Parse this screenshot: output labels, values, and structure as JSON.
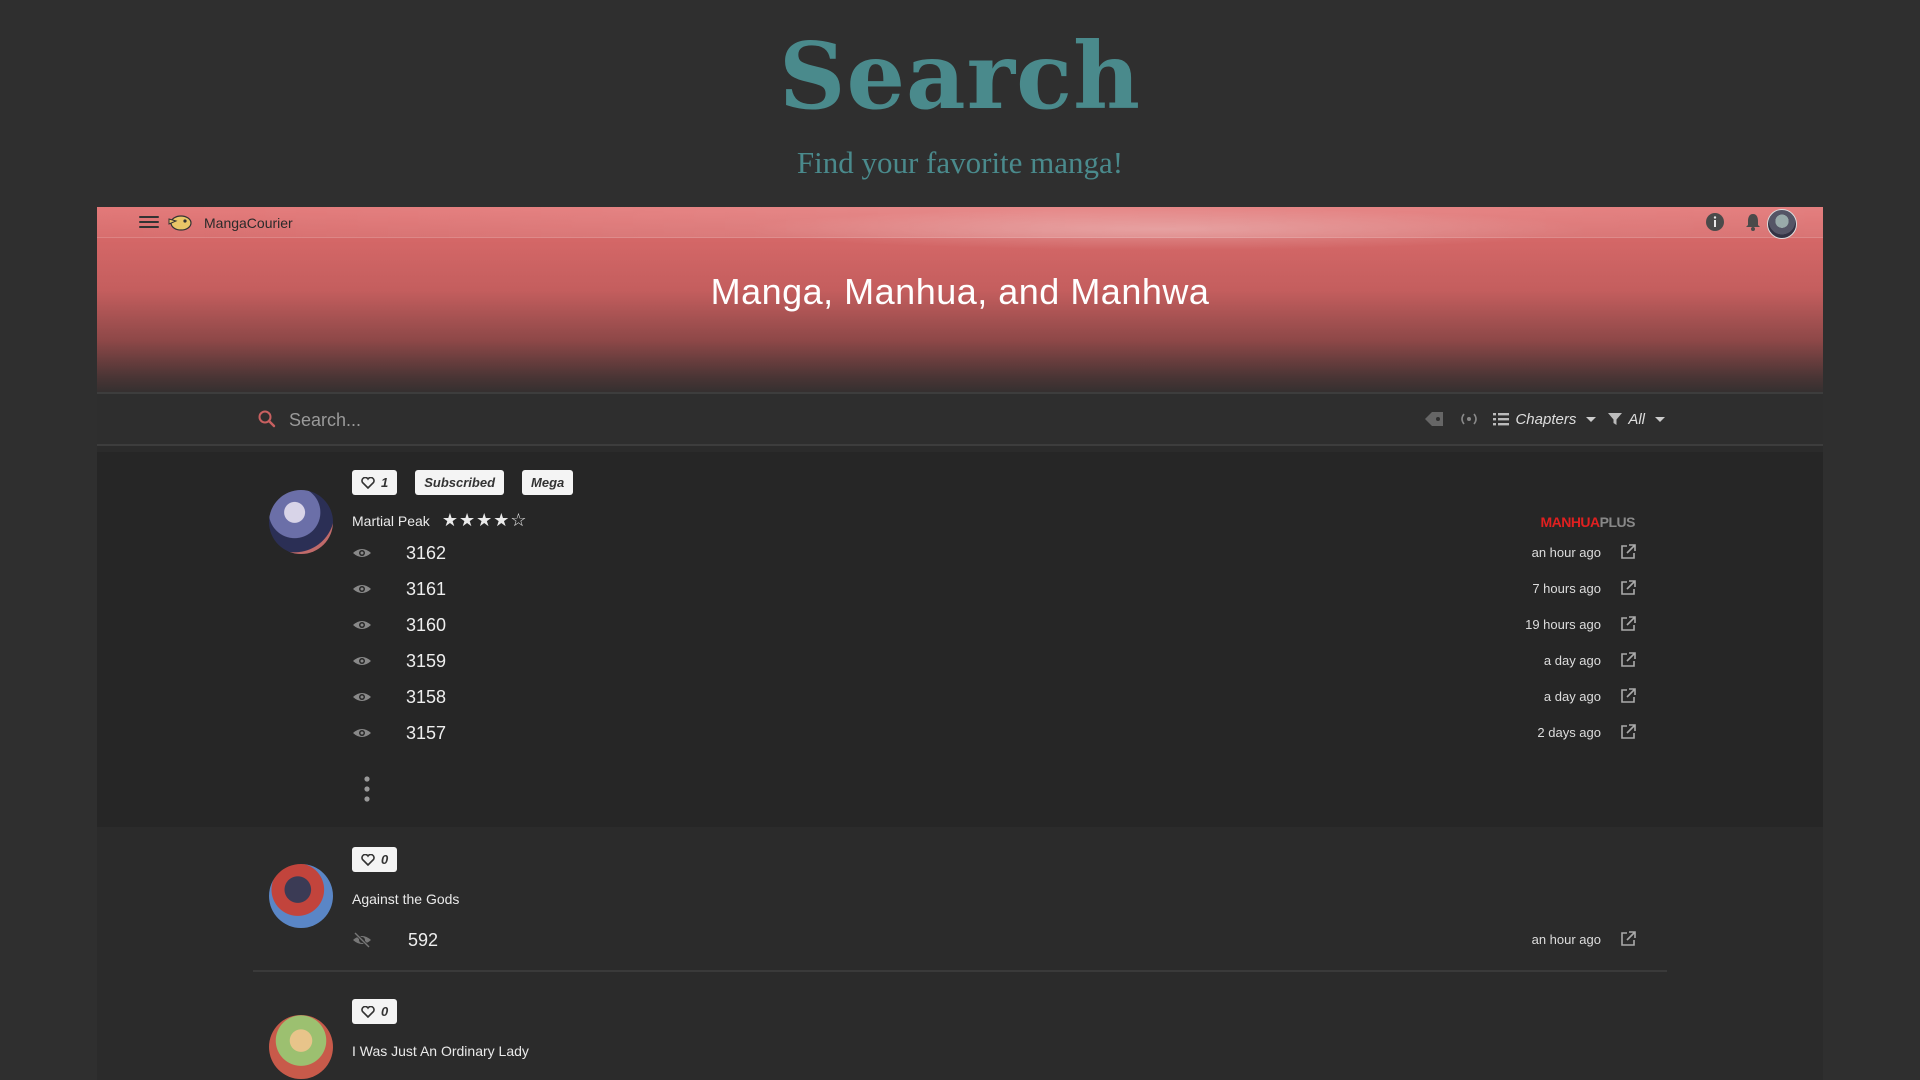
{
  "header": {
    "title": "Search",
    "subtitle": "Find your favorite manga!"
  },
  "topbar": {
    "app_name": "MangaCourier",
    "icons": [
      "menu-icon",
      "logo-icon",
      "info-icon",
      "bell-icon",
      "avatar"
    ]
  },
  "hero": {
    "title": "Manga, Manhua, and Manhwa"
  },
  "search": {
    "placeholder": "Search...",
    "chapters_label": "Chapters",
    "filter_label": "All"
  },
  "entries": [
    {
      "title": "Martial Peak",
      "likes": "1",
      "badges": [
        "Subscribed",
        "Mega"
      ],
      "rating_stars": "★★★★☆",
      "rating": 4,
      "source": "MANHUAPLUS",
      "chapters": [
        {
          "number": "3162",
          "time": "an hour ago"
        },
        {
          "number": "3161",
          "time": "7 hours ago"
        },
        {
          "number": "3160",
          "time": "19 hours ago"
        },
        {
          "number": "3159",
          "time": "a day ago"
        },
        {
          "number": "3158",
          "time": "a day ago"
        },
        {
          "number": "3157",
          "time": "2 days ago"
        }
      ]
    },
    {
      "title": "Against the Gods",
      "likes": "0",
      "chapters": [
        {
          "number": "592",
          "time": "an hour ago",
          "read": true
        }
      ]
    },
    {
      "title": "I Was Just An Ordinary Lady",
      "likes": "0",
      "chapters": []
    }
  ],
  "colors": {
    "accent": "#4a8a8c",
    "hero_top": "#e27474",
    "background": "#2f2f2f"
  }
}
